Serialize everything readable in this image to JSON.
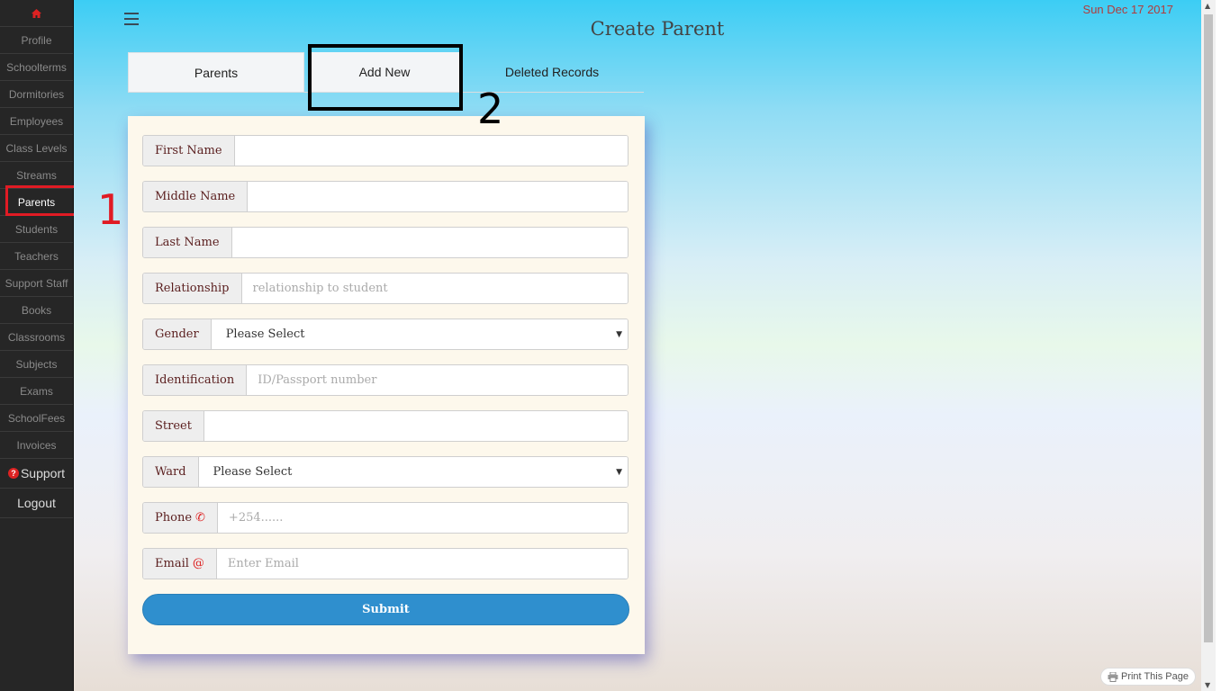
{
  "sidebar": {
    "home_icon": "home-icon",
    "items": [
      {
        "label": "Profile",
        "name": "sidebar-item-profile"
      },
      {
        "label": "Schoolterms",
        "name": "sidebar-item-schoolterms"
      },
      {
        "label": "Dormitories",
        "name": "sidebar-item-dormitories"
      },
      {
        "label": "Employees",
        "name": "sidebar-item-employees"
      },
      {
        "label": "Class Levels",
        "name": "sidebar-item-class-levels"
      },
      {
        "label": "Streams",
        "name": "sidebar-item-streams"
      },
      {
        "label": "Parents",
        "name": "sidebar-item-parents",
        "active": true
      },
      {
        "label": "Students",
        "name": "sidebar-item-students"
      },
      {
        "label": "Teachers",
        "name": "sidebar-item-teachers"
      },
      {
        "label": "Support Staff",
        "name": "sidebar-item-support-staff"
      },
      {
        "label": "Books",
        "name": "sidebar-item-books"
      },
      {
        "label": "Classrooms",
        "name": "sidebar-item-classrooms"
      },
      {
        "label": "Subjects",
        "name": "sidebar-item-subjects"
      },
      {
        "label": "Exams",
        "name": "sidebar-item-exams"
      },
      {
        "label": "SchoolFees",
        "name": "sidebar-item-schoolfees"
      },
      {
        "label": "Invoices",
        "name": "sidebar-item-invoices"
      }
    ],
    "support_label": "Support",
    "logout_label": "Logout"
  },
  "header": {
    "title": "Create Parent",
    "date": "Sun Dec 17 2017"
  },
  "tabs": [
    {
      "label": "Parents"
    },
    {
      "label": "Add New"
    },
    {
      "label": "Deleted Records"
    }
  ],
  "form": {
    "first_name": {
      "label": "First Name",
      "placeholder": ""
    },
    "middle_name": {
      "label": "Middle Name",
      "placeholder": ""
    },
    "last_name": {
      "label": "Last Name",
      "placeholder": ""
    },
    "relationship": {
      "label": "Relationship",
      "placeholder": "relationship to student"
    },
    "gender": {
      "label": "Gender",
      "selected": "Please Select"
    },
    "identification": {
      "label": "Identification",
      "placeholder": "ID/Passport number"
    },
    "street": {
      "label": "Street",
      "placeholder": ""
    },
    "ward": {
      "label": "Ward",
      "selected": "Please Select"
    },
    "phone": {
      "label": "Phone",
      "placeholder": "+254......",
      "icon": "phone-icon"
    },
    "email": {
      "label": "Email",
      "placeholder": "Enter Email",
      "icon": "at-icon"
    },
    "submit_label": "Submit"
  },
  "annotations": {
    "one": "1",
    "two": "2"
  },
  "footer": {
    "print_label": "Print This Page"
  },
  "colors": {
    "sidebar_bg": "#262626",
    "accent": "#2f8fce",
    "date": "#b23b3b",
    "annotation_red": "#e01b24"
  }
}
